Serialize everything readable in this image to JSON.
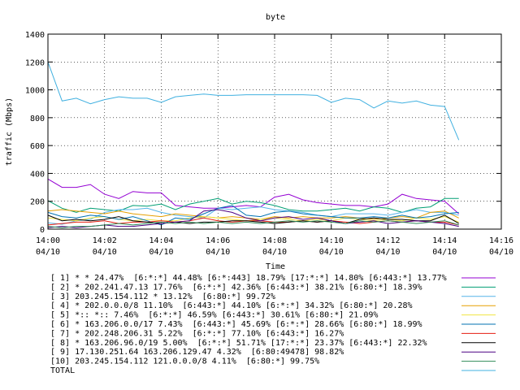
{
  "chart_data": {
    "type": "line",
    "title": "byte",
    "xlabel": "Time",
    "ylabel": "traffic (Mbps)",
    "ylim": [
      0,
      1400
    ],
    "yticks": [
      0,
      200,
      400,
      600,
      800,
      1000,
      1200,
      1400
    ],
    "xlim": [
      0,
      16
    ],
    "xticks": [
      {
        "v": 0,
        "time": "14:00",
        "date": "04/10"
      },
      {
        "v": 2,
        "time": "14:02",
        "date": "04/10"
      },
      {
        "v": 4,
        "time": "14:04",
        "date": "04/10"
      },
      {
        "v": 6,
        "time": "14:06",
        "date": "04/10"
      },
      {
        "v": 8,
        "time": "14:08",
        "date": "04/10"
      },
      {
        "v": 10,
        "time": "14:10",
        "date": "04/10"
      },
      {
        "v": 12,
        "time": "14:12",
        "date": "04/10"
      },
      {
        "v": 14,
        "time": "14:14",
        "date": "04/10"
      },
      {
        "v": 16,
        "time": "14:16",
        "date": "04/10"
      }
    ],
    "grid": true,
    "legend_position": "bottom",
    "x": [
      0,
      0.5,
      1,
      1.5,
      2,
      2.5,
      3,
      3.5,
      4,
      4.5,
      5,
      5.5,
      6,
      6.5,
      7,
      7.5,
      8,
      8.5,
      9,
      9.5,
      10,
      10.5,
      11,
      11.5,
      12,
      12.5,
      13,
      13.5,
      14,
      14.5
    ],
    "series": [
      {
        "name": "[ 1] * * 24.47%  [6:*:*] 44.48% [6:*:443] 18.79% [17:*:*] 14.80% [6:443:*] 13.77%",
        "color": "#9400d3",
        "values": [
          360,
          300,
          300,
          320,
          250,
          220,
          270,
          260,
          260,
          170,
          160,
          150,
          150,
          160,
          170,
          160,
          230,
          250,
          210,
          190,
          180,
          170,
          170,
          160,
          180,
          250,
          220,
          210,
          200,
          110
        ]
      },
      {
        "name": "[ 2] * 202.241.47.13 17.76%  [6:*:*] 42.36% [6:443:*] 38.21% [6:80:*] 18.39%",
        "color": "#009e73",
        "values": [
          205,
          150,
          120,
          150,
          140,
          130,
          170,
          165,
          180,
          140,
          180,
          200,
          220,
          180,
          200,
          190,
          170,
          140,
          130,
          130,
          140,
          150,
          130,
          160,
          150,
          120,
          150,
          160,
          220,
          220
        ]
      },
      {
        "name": "[ 3] 203.245.154.112 * 13.12%  [6:80:*] 99.72%",
        "color": "#56b4e9",
        "values": [
          45,
          35,
          60,
          70,
          120,
          140,
          140,
          150,
          120,
          100,
          90,
          80,
          150,
          140,
          150,
          160,
          140,
          130,
          120,
          100,
          90,
          110,
          110,
          110,
          100,
          120,
          140,
          120,
          120,
          100
        ]
      },
      {
        "name": "[ 4] * 202.0.0.0/8 11.10%  [6:443:*] 44.10% [6:*:*] 34.32% [6:80:*] 20.28%",
        "color": "#e69f00",
        "values": [
          130,
          140,
          130,
          120,
          110,
          130,
          110,
          100,
          90,
          110,
          100,
          90,
          80,
          90,
          80,
          70,
          90,
          80,
          90,
          80,
          80,
          90,
          80,
          70,
          80,
          90,
          80,
          120,
          130,
          80
        ]
      },
      {
        "name": "[ 5] *:: *:: 7.46%  [6:*:*] 46.59% [6:443:*] 30.61% [6:80:*] 21.09%",
        "color": "#f0e442",
        "values": [
          80,
          70,
          60,
          80,
          90,
          70,
          60,
          70,
          60,
          60,
          80,
          90,
          80,
          70,
          60,
          70,
          80,
          70,
          60,
          70,
          60,
          80,
          70,
          60,
          70,
          60,
          80,
          70,
          90,
          50
        ]
      },
      {
        "name": "[ 6] * 163.206.0.0/17 7.43%  [6:443:*] 45.69% [6:*:*] 28.66% [6:80:*] 18.99%",
        "color": "#0072b2",
        "values": [
          120,
          90,
          80,
          100,
          90,
          70,
          90,
          60,
          30,
          80,
          70,
          110,
          150,
          170,
          100,
          90,
          120,
          130,
          110,
          100,
          90,
          80,
          80,
          90,
          80,
          100,
          80,
          90,
          110,
          120
        ]
      },
      {
        "name": "[ 7] * 202.248.206.31 5.22%  [6:*:*] 77.10% [6:443:*] 16.27%",
        "color": "#e51e10",
        "values": [
          30,
          40,
          50,
          50,
          60,
          40,
          50,
          50,
          60,
          50,
          60,
          80,
          60,
          50,
          60,
          60,
          50,
          50,
          60,
          50,
          60,
          50,
          40,
          50,
          60,
          50,
          60,
          50,
          50,
          30
        ]
      },
      {
        "name": "[ 8] * 163.206.96.0/19 5.00%  [6:*:*] 51.71% [17:*:*] 23.37% [6:443:*] 22.32%",
        "color": "#000000",
        "values": [
          100,
          60,
          70,
          60,
          70,
          90,
          60,
          50,
          40,
          50,
          40,
          50,
          50,
          60,
          60,
          50,
          40,
          50,
          60,
          50,
          60,
          40,
          70,
          80,
          70,
          70,
          60,
          60,
          100,
          40
        ]
      },
      {
        "name": "[ 9] 17.130.251.64 163.206.129.47 4.32%  [6:80:49478] 98.82%",
        "color": "#4b0082",
        "values": [
          10,
          20,
          10,
          20,
          30,
          20,
          20,
          30,
          40,
          50,
          60,
          130,
          140,
          120,
          80,
          60,
          80,
          90,
          70,
          80,
          60,
          40,
          50,
          60,
          40,
          50,
          60,
          50,
          40,
          20
        ]
      },
      {
        "name": "[10] 203.245.154.112 121.0.0.0/8 4.11%  [6:80:*] 99.75%",
        "color": "#2e8b57",
        "values": [
          20,
          10,
          20,
          20,
          30,
          40,
          30,
          40,
          50,
          40,
          50,
          40,
          50,
          40,
          50,
          40,
          50,
          60,
          50,
          60,
          50,
          40,
          60,
          50,
          60,
          50,
          40,
          50,
          60,
          30
        ]
      },
      {
        "name": "TOTAL",
        "color": "#40b0e0",
        "values": [
          1200,
          920,
          940,
          900,
          930,
          950,
          940,
          940,
          910,
          950,
          960,
          970,
          960,
          960,
          965,
          965,
          965,
          965,
          965,
          960,
          910,
          940,
          930,
          870,
          920,
          905,
          920,
          890,
          880,
          640
        ]
      }
    ]
  }
}
